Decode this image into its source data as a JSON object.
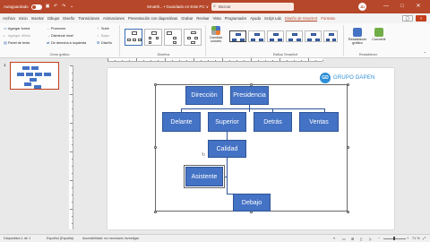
{
  "titlebar": {
    "autosave_label": "Autoguardado",
    "doc_title": "Smartlr... • Guardado en Este PC ∨",
    "search_placeholder": "Buscar",
    "avatar": "JD",
    "window_controls": [
      "—",
      "□",
      "✕"
    ]
  },
  "tabs": [
    {
      "label": "Archivo"
    },
    {
      "label": "Inicio"
    },
    {
      "label": "Insertar"
    },
    {
      "label": "Dibujar"
    },
    {
      "label": "Diseño"
    },
    {
      "label": "Transiciones"
    },
    {
      "label": "Animaciones"
    },
    {
      "label": "Presentación con diapositivas"
    },
    {
      "label": "Grabar"
    },
    {
      "label": "Revisar"
    },
    {
      "label": "Vista"
    },
    {
      "label": "Programador"
    },
    {
      "label": "Ayuda"
    },
    {
      "label": "Script Lab"
    },
    {
      "label": "Diseño de SmartArt"
    },
    {
      "label": "Formato"
    }
  ],
  "ribbon": {
    "crear_grafico": {
      "items": [
        "Agregar forma",
        "Agregar viñeta",
        "Panel de texto",
        "Promover",
        "Disminuir nivel",
        "De derecha a izquierda",
        "Subir",
        "Bajar",
        "Diseño"
      ],
      "title": "Crear gráfico"
    },
    "disenos": {
      "title": "Diseños"
    },
    "cambiar_colores": "Cambiar colores",
    "estilos": {
      "title": "Estilos SmartArt"
    },
    "restablecer": {
      "convert_label": "Restablecer gráfico",
      "convertir_label": "Convertir",
      "title": "Restablecer"
    }
  },
  "slide_panel": {
    "slide_number": "1"
  },
  "logo": {
    "initials": "GD",
    "text": "GRUPO DAPEN"
  },
  "org_chart": {
    "boxes": {
      "direccion": "Dirección",
      "presidencia": "Presidencia",
      "delante": "Delante",
      "superior": "Superior",
      "detras": "Detrás",
      "ventas": "Ventas",
      "calidad": "Calidad",
      "asistente": "Asistente",
      "debajo": "Debajo"
    }
  },
  "status": {
    "slide_of": "Diapositiva 1 de 1",
    "language": "Español (España)",
    "accessibility": "Accesibilidad: es necesario investigar",
    "zoom": "71 %"
  },
  "colors": {
    "accent": "#b7472a",
    "smartart_blue": "#4472c4",
    "logo_blue": "#2e8fd6"
  }
}
